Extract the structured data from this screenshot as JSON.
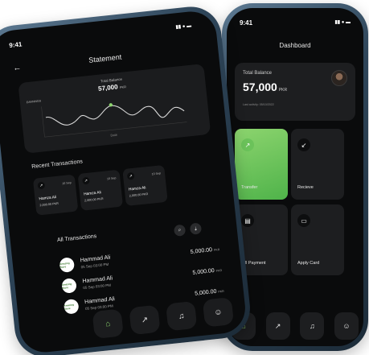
{
  "dashboard": {
    "status_time": "9:41",
    "status_icons": "▮▮ ● ▬",
    "title": "Dashboard",
    "balance": {
      "label": "Total Balance",
      "amount": "57,000",
      "currency": "PKR",
      "last_activity": "Last activity: 05/10/2022"
    },
    "tiles": [
      {
        "label": "Transfer",
        "icon": "↗"
      },
      {
        "label": "Recieve",
        "icon": "↙"
      },
      {
        "label": "Bill Payment",
        "icon": "▤"
      },
      {
        "label": "Apply Card",
        "icon": "▭"
      }
    ],
    "nav": [
      "⌂",
      "↗",
      "♫",
      "☺"
    ]
  },
  "statement": {
    "status_time": "9:41",
    "status_icons": "▮▮ ● ▬",
    "back_icon": "←",
    "title": "Statement",
    "chart": {
      "total_label": "Total Balance",
      "amount": "57,000",
      "currency": "PKR",
      "earnings_label": "EARNINGS",
      "x_label": "Date"
    },
    "recent_title": "Recent Transactions",
    "recent": [
      {
        "icon": "↗",
        "date": "10 Sep",
        "name": "Hamza Ali",
        "amount": "2,000.00",
        "currency": "PKR"
      },
      {
        "icon": "↗",
        "date": "10 Sep",
        "name": "Hamza Ali",
        "amount": "2,000.00",
        "currency": "PKR"
      },
      {
        "icon": "↗",
        "date": "10 Sep",
        "name": "Hamza Ali",
        "amount": "2,000.00",
        "currency": "PKR"
      }
    ],
    "all_title": "All Transactions",
    "all": [
      {
        "name": "Hammad Ali",
        "date": "05 Sep 03:00 PM",
        "amount": "5,000.00",
        "currency": "PKR",
        "logo_text": "Amazing Store"
      },
      {
        "name": "Hammad Ali",
        "date": "05 Sep 03:00 PM",
        "amount": "5,000.00",
        "currency": "PKR",
        "logo_text": "Amazing Store"
      },
      {
        "name": "Hammad Ali",
        "date": "05 Sep 03:00 PM",
        "amount": "5,000.00",
        "currency": "PKR",
        "logo_text": "Amazing Store"
      }
    ],
    "nav": [
      "⌂",
      "↗",
      "♫",
      "☺"
    ]
  }
}
